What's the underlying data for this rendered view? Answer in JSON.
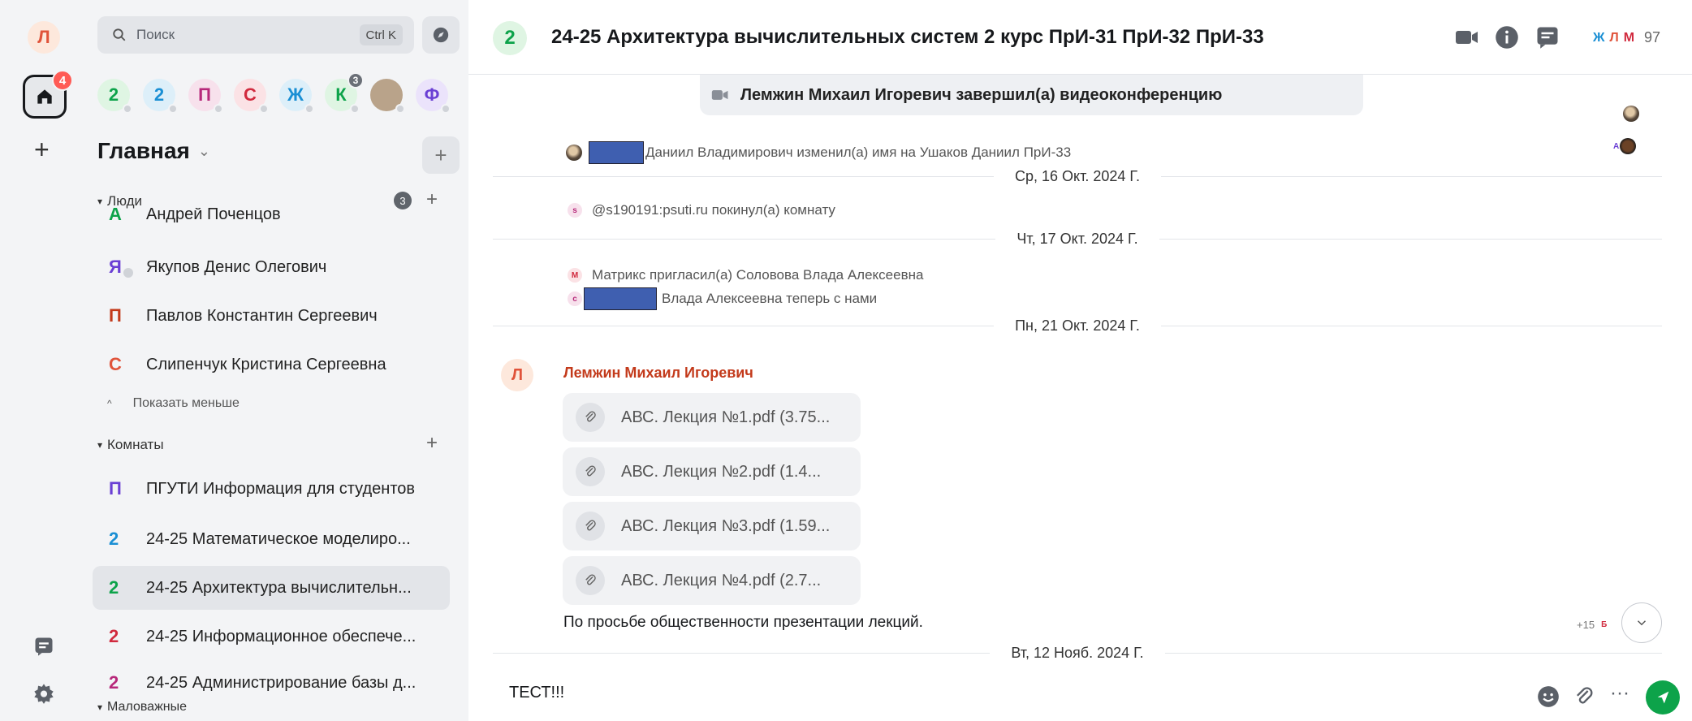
{
  "rail": {
    "user_initial": "Л",
    "home_badge": "4",
    "add_label": "+"
  },
  "search": {
    "placeholder": "Поиск",
    "shortcut": "Ctrl K"
  },
  "spaces": [
    {
      "label": "2",
      "color": "#0da34a",
      "bg": "#dff5e3"
    },
    {
      "label": "2",
      "color": "#1a8fd4",
      "bg": "#ddeff9"
    },
    {
      "label": "П",
      "color": "#b7287a",
      "bg": "#f7e1ec"
    },
    {
      "label": "С",
      "color": "#d12a3e",
      "bg": "#fbe2e5"
    },
    {
      "label": "Ж",
      "color": "#1a8fd4",
      "bg": "#ddeff9"
    },
    {
      "label": "К",
      "color": "#0da34a",
      "bg": "#dff5e3",
      "badge": "3"
    },
    {
      "label": "",
      "color": "#5a4a3c",
      "bg": "#b9a38a"
    },
    {
      "label": "Ф",
      "color": "#6a3fd4",
      "bg": "#ebe3fb"
    }
  ],
  "home": {
    "title": "Главная"
  },
  "people": {
    "header": "Люди",
    "count": "3",
    "items": [
      {
        "initial": "А",
        "name": "Андрей Поченцов",
        "color": "#0da34a"
      },
      {
        "initial": "Я",
        "name": "Якупов Денис Олегович",
        "color": "#6a3fd4"
      },
      {
        "initial": "П",
        "name": "Павлов Константин Сергеевич",
        "color": "#c33a1b"
      },
      {
        "initial": "С",
        "name": "Слипенчук Кристина Сергеевна",
        "color": "#e0533a"
      }
    ],
    "show_less": "Показать меньше"
  },
  "rooms": {
    "header": "Комнаты",
    "items": [
      {
        "initial": "П",
        "name": "ПГУТИ Информация для студентов",
        "color": "#6a3fd4"
      },
      {
        "initial": "2",
        "name": "24-25 Математическое моделиро...",
        "color": "#1a8fd4"
      },
      {
        "initial": "2",
        "name": "24-25 Архитектура вычислительн...",
        "color": "#0da34a"
      },
      {
        "initial": "2",
        "name": "24-25 Информационное обеспече...",
        "color": "#d12a3e"
      },
      {
        "initial": "2",
        "name": "24-25 Администрирование базы д...",
        "color": "#b7287a"
      }
    ]
  },
  "low_priority": {
    "header": "Маловажные"
  },
  "header": {
    "room_initial": "2",
    "room_title": "24-25 Архитектура вычислительных систем 2 курс ПрИ-31 ПрИ-32 ПрИ-33",
    "members": [
      {
        "initial": "Ж",
        "color": "#1a8fd4"
      },
      {
        "initial": "Л",
        "color": "#e0533a"
      },
      {
        "initial": "М",
        "color": "#d12a3e"
      }
    ],
    "member_count": "97"
  },
  "timeline": {
    "call_ended": "Лемжин Михаил Игоревич завершил(а) видеоконференцию",
    "rename_event": "Даниил Владимирович изменил(а) имя на Ушаков Даниил ПрИ-33",
    "date1": "Ср, 16 Окт. 2024 Г.",
    "left_initial": "s",
    "left_event": "@s190191:psuti.ru покинул(а) комнату",
    "date2": "Чт, 17 Окт. 2024 Г.",
    "invite_initial": "М",
    "invite_event": "Матрикс пригласил(а) Соловова Влада Алексеевна",
    "join_initial": "с",
    "join_event": "Влада Алексеевна теперь с нами",
    "date3": "Пн, 21 Окт. 2024 Г.",
    "sender_initial": "Л",
    "sender": "Лемжин Михаил Игоревич",
    "files": [
      "АВС. Лекция №1.pdf (3.75...",
      "АВС. Лекция №2.pdf (1.4...",
      "АВС. Лекция №3.pdf (1.59...",
      "АВС. Лекция №4.pdf (2.7..."
    ],
    "message": "По просьбе общественности презентации лекций.",
    "read_more": "+15",
    "read_initial": "Б",
    "date4": "Вт, 12 Нояб. 2024 Г."
  },
  "composer": {
    "value": "ТЕСТ!!!"
  },
  "colors": {
    "accent": "#0da34a",
    "badge": "#ff5b55",
    "redact": "#3f5fb0"
  }
}
